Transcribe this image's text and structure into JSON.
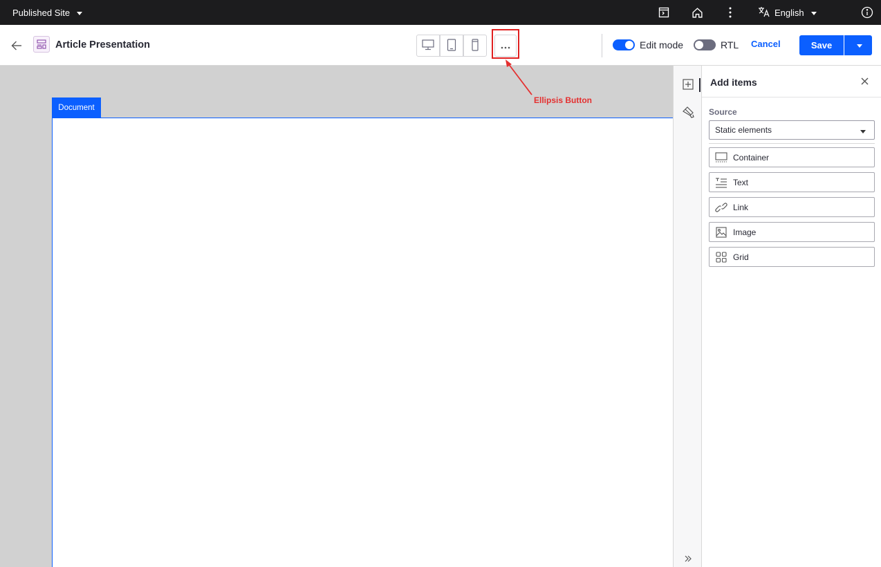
{
  "topbar": {
    "site_label": "Published Site",
    "language": "English",
    "icons": [
      "page-structure-icon",
      "home-icon",
      "vertical-ellipsis-icon",
      "translate-icon",
      "info-icon"
    ]
  },
  "toolbar": {
    "page_title": "Article Presentation",
    "devices": [
      "desktop-icon",
      "tablet-icon",
      "mobile-icon"
    ],
    "edit_mode_label": "Edit mode",
    "edit_mode_on": true,
    "rtl_label": "RTL",
    "rtl_on": false,
    "cancel_label": "Cancel",
    "save_label": "Save"
  },
  "canvas": {
    "document_tab": "Document"
  },
  "annotation": {
    "label": "Ellipsis Button",
    "color": "#e43030"
  },
  "panel": {
    "title": "Add items",
    "source_label": "Source",
    "source_value": "Static elements",
    "items": [
      {
        "label": "Container",
        "icon": "container-icon"
      },
      {
        "label": "Text",
        "icon": "text-icon"
      },
      {
        "label": "Link",
        "icon": "link-icon"
      },
      {
        "label": "Image",
        "icon": "image-icon"
      },
      {
        "label": "Grid",
        "icon": "grid-icon"
      }
    ]
  },
  "colors": {
    "accent": "#0b5fff",
    "topbar_bg": "#1c1c1e",
    "canvas_bg": "#d1d1d1"
  }
}
